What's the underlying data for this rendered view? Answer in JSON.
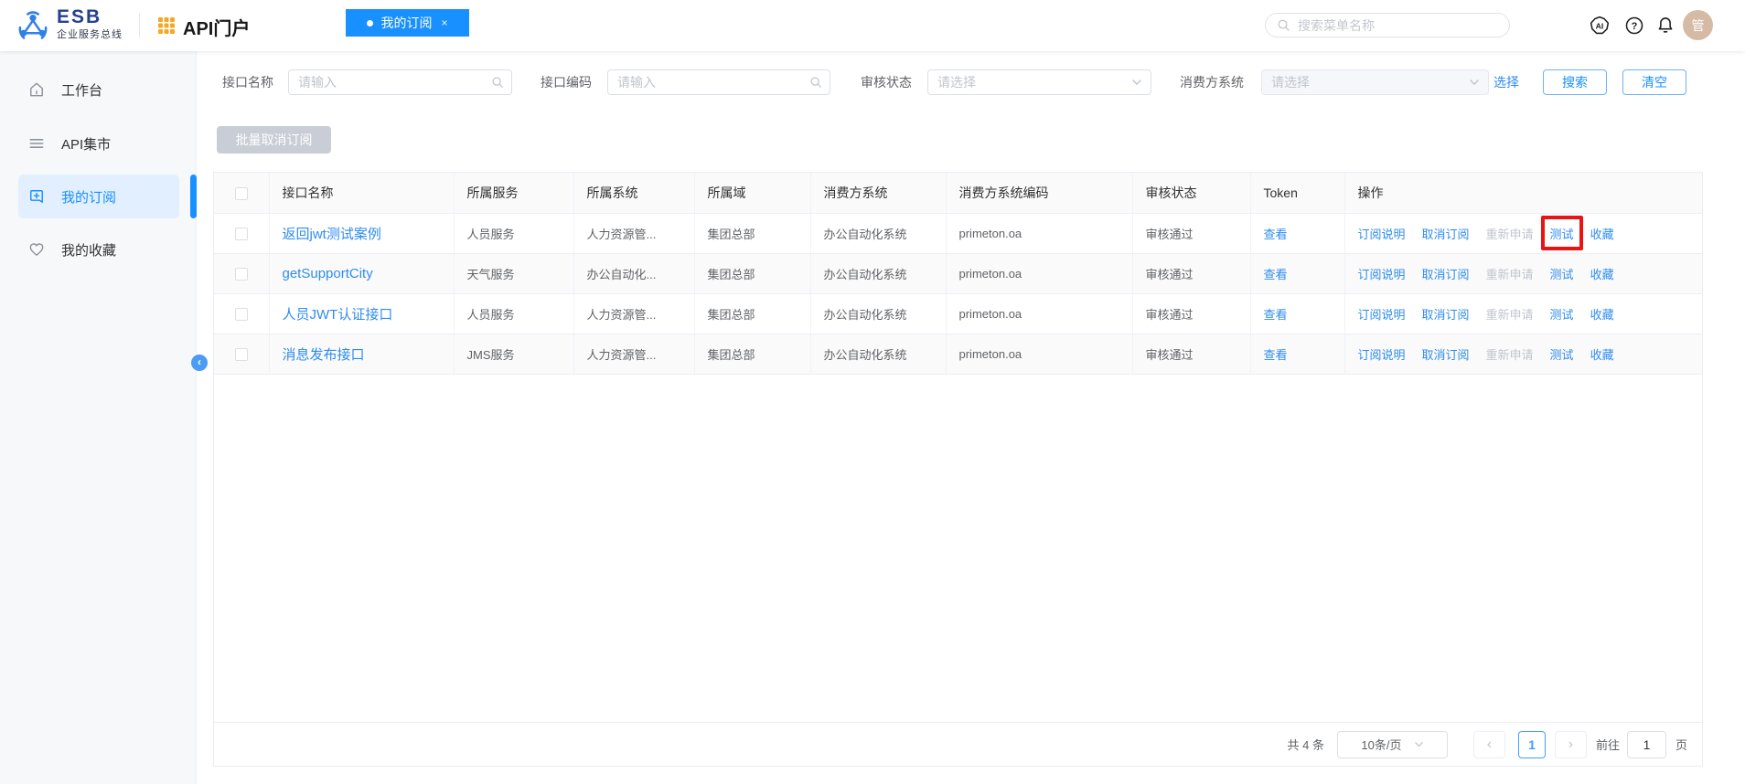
{
  "topbar": {
    "brand": "ESB",
    "brand_subtitle": "企业服务总线",
    "portal_title": "API门户",
    "active_tab": {
      "label": "我的订阅",
      "close": "×"
    },
    "menu_search_placeholder": "搜索菜单名称",
    "avatar_text": "管"
  },
  "sidebar": {
    "items": [
      {
        "key": "workbench",
        "label": "工作台",
        "icon": "home-icon",
        "active": false
      },
      {
        "key": "api-market",
        "label": "API集市",
        "icon": "menu-icon",
        "active": false
      },
      {
        "key": "my-subscriptions",
        "label": "我的订阅",
        "icon": "bookmark-plus-icon",
        "active": true
      },
      {
        "key": "my-favorites",
        "label": "我的收藏",
        "icon": "heart-icon",
        "active": false
      }
    ]
  },
  "filters": {
    "interface_name": {
      "label": "接口名称",
      "placeholder": "请输入"
    },
    "interface_code": {
      "label": "接口编码",
      "placeholder": "请输入"
    },
    "audit_status": {
      "label": "审核状态",
      "placeholder": "请选择"
    },
    "consumer_system": {
      "label": "消费方系统",
      "placeholder": "请选择",
      "disabled": true
    },
    "select_link": "选择",
    "search_button": "搜索",
    "clear_button": "清空"
  },
  "toolbar": {
    "batch_unsubscribe": "批量取消订阅"
  },
  "table": {
    "columns": [
      "接口名称",
      "所属服务",
      "所属系统",
      "所属域",
      "消费方系统",
      "消费方系统编码",
      "审核状态",
      "Token",
      "操作"
    ],
    "actions": [
      {
        "key": "subscription-info",
        "label": "订阅说明",
        "disabled": false
      },
      {
        "key": "unsubscribe",
        "label": "取消订阅",
        "disabled": false
      },
      {
        "key": "reapply",
        "label": "重新申请",
        "disabled": true
      },
      {
        "key": "test",
        "label": "测试",
        "disabled": false
      },
      {
        "key": "favorite",
        "label": "收藏",
        "disabled": false
      }
    ],
    "rows": [
      {
        "name": "返回jwt测试案例",
        "service": "人员服务",
        "system": "人力资源管...",
        "domain": "集团总部",
        "consumer_system": "办公自动化系统",
        "consumer_code": "primeton.oa",
        "status": "审核通过",
        "token": "查看",
        "highlight_action": "test"
      },
      {
        "name": "getSupportCity",
        "service": "天气服务",
        "system": "办公自动化...",
        "domain": "集团总部",
        "consumer_system": "办公自动化系统",
        "consumer_code": "primeton.oa",
        "status": "审核通过",
        "token": "查看"
      },
      {
        "name": "人员JWT认证接口",
        "service": "人员服务",
        "system": "人力资源管...",
        "domain": "集团总部",
        "consumer_system": "办公自动化系统",
        "consumer_code": "primeton.oa",
        "status": "审核通过",
        "token": "查看"
      },
      {
        "name": "消息发布接口",
        "service": "JMS服务",
        "system": "人力资源管...",
        "domain": "集团总部",
        "consumer_system": "办公自动化系统",
        "consumer_code": "primeton.oa",
        "status": "审核通过",
        "token": "查看"
      }
    ]
  },
  "pagination": {
    "total": "共 4 条",
    "page_size": "10条/页",
    "current_page": "1",
    "goto_label": "前往",
    "goto_value": "1",
    "page_unit": "页"
  },
  "colors": {
    "primary": "#1890ff",
    "link": "#2d8cf0",
    "disabled_text": "#c0c4cc",
    "annotation_red": "#ec1313",
    "brand_navy": "#25408f",
    "brand_orange": "#f7a724",
    "sidebar_active_bg": "#e1efff",
    "table_header_bg": "#fafafa"
  }
}
